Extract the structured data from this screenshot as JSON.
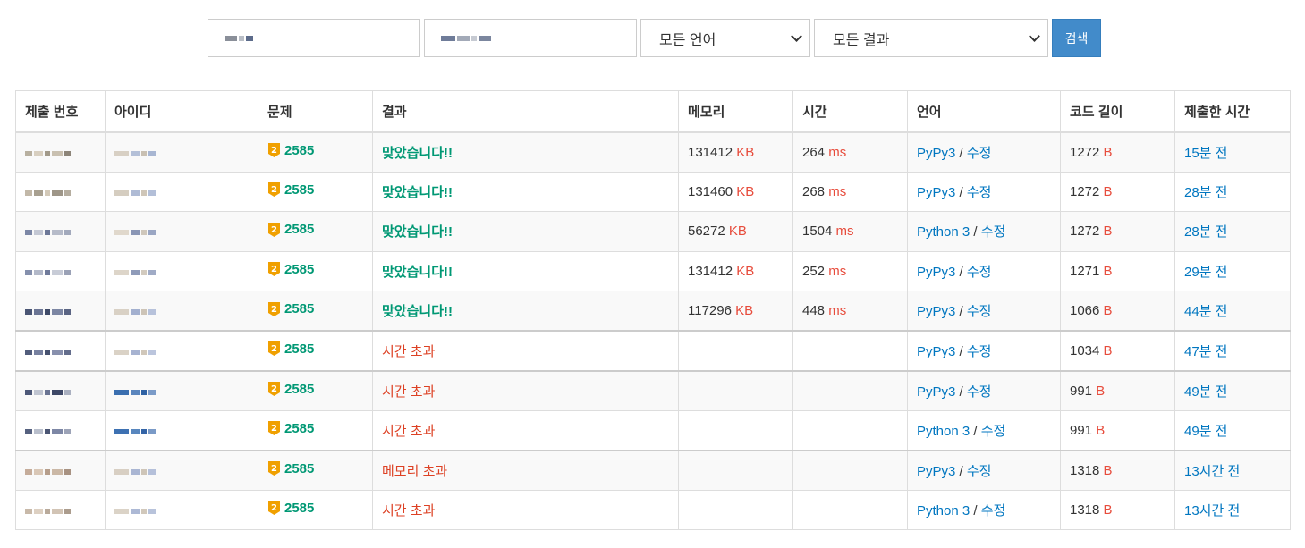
{
  "filters": {
    "user_value": "",
    "problem_value": "",
    "language": "모든 언어",
    "result": "모든 결과",
    "search_label": "검색"
  },
  "table": {
    "headers": [
      "제출 번호",
      "아이디",
      "문제",
      "결과",
      "메모리",
      "시간",
      "언어",
      "코드 길이",
      "제출한 시간"
    ],
    "rows": [
      {
        "problem": "2585",
        "result": "맞았습니다!!",
        "result_type": "ac",
        "memory": "131412",
        "memory_unit": "KB",
        "time": "264",
        "time_unit": "ms",
        "language": "PyPy3",
        "edit": "수정",
        "code_length": "1272",
        "code_unit": "B",
        "submitted": "15분 전"
      },
      {
        "problem": "2585",
        "result": "맞았습니다!!",
        "result_type": "ac",
        "memory": "131460",
        "memory_unit": "KB",
        "time": "268",
        "time_unit": "ms",
        "language": "PyPy3",
        "edit": "수정",
        "code_length": "1272",
        "code_unit": "B",
        "submitted": "28분 전"
      },
      {
        "problem": "2585",
        "result": "맞았습니다!!",
        "result_type": "ac",
        "memory": "56272",
        "memory_unit": "KB",
        "time": "1504",
        "time_unit": "ms",
        "language": "Python 3",
        "edit": "수정",
        "code_length": "1272",
        "code_unit": "B",
        "submitted": "28분 전"
      },
      {
        "problem": "2585",
        "result": "맞았습니다!!",
        "result_type": "ac",
        "memory": "131412",
        "memory_unit": "KB",
        "time": "252",
        "time_unit": "ms",
        "language": "PyPy3",
        "edit": "수정",
        "code_length": "1271",
        "code_unit": "B",
        "submitted": "29분 전"
      },
      {
        "problem": "2585",
        "result": "맞았습니다!!",
        "result_type": "ac",
        "memory": "117296",
        "memory_unit": "KB",
        "time": "448",
        "time_unit": "ms",
        "language": "PyPy3",
        "edit": "수정",
        "code_length": "1066",
        "code_unit": "B",
        "submitted": "44분 전"
      },
      {
        "problem": "2585",
        "result": "시간 초과",
        "result_type": "wa",
        "memory": "",
        "memory_unit": "",
        "time": "",
        "time_unit": "",
        "language": "PyPy3",
        "edit": "수정",
        "code_length": "1034",
        "code_unit": "B",
        "submitted": "47분 전"
      },
      {
        "problem": "2585",
        "result": "시간 초과",
        "result_type": "wa",
        "memory": "",
        "memory_unit": "",
        "time": "",
        "time_unit": "",
        "language": "PyPy3",
        "edit": "수정",
        "code_length": "991",
        "code_unit": "B",
        "submitted": "49분 전"
      },
      {
        "problem": "2585",
        "result": "시간 초과",
        "result_type": "wa",
        "memory": "",
        "memory_unit": "",
        "time": "",
        "time_unit": "",
        "language": "Python 3",
        "edit": "수정",
        "code_length": "991",
        "code_unit": "B",
        "submitted": "49분 전"
      },
      {
        "problem": "2585",
        "result": "메모리 초과",
        "result_type": "wa",
        "memory": "",
        "memory_unit": "",
        "time": "",
        "time_unit": "",
        "language": "PyPy3",
        "edit": "수정",
        "code_length": "1318",
        "code_unit": "B",
        "submitted": "13시간 전"
      },
      {
        "problem": "2585",
        "result": "시간 초과",
        "result_type": "wa",
        "memory": "",
        "memory_unit": "",
        "time": "",
        "time_unit": "",
        "language": "Python 3",
        "edit": "수정",
        "code_length": "1318",
        "code_unit": "B",
        "submitted": "13시간 전"
      }
    ]
  },
  "colors": {
    "accepted": "#009874",
    "error": "#dd4124",
    "unit": "#e74c3c",
    "link": "#0076c0",
    "button": "#428bca",
    "tier_badge": "#f0a000"
  },
  "icons": {
    "tier": "silver-tier-badge-icon",
    "dropdown": "chevron-down-icon"
  }
}
